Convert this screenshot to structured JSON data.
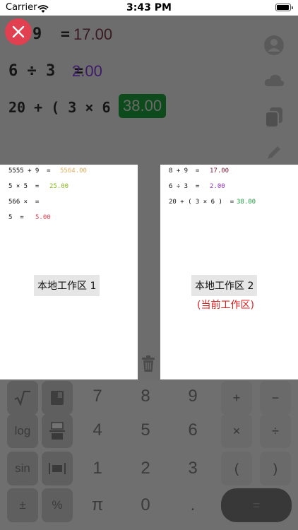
{
  "status_bar": {
    "carrier": "Carrier",
    "time": "3:43 PM"
  },
  "main": {
    "expressions": [
      {
        "expr": "9  =",
        "result": "17.00",
        "color": "#3a1a22"
      },
      {
        "expr": "6 ÷ 3  =",
        "result": "2.00",
        "color": "#3e1b6b"
      },
      {
        "expr": "20 + ( 3 × 6 )  =",
        "result": "38.00",
        "color": "#0d4a1c"
      }
    ],
    "side_icons": [
      "person-icon",
      "cloud-icon",
      "copy-icon",
      "pen-icon"
    ]
  },
  "workspaces": [
    {
      "lines": [
        {
          "expr": "5555 + 9  =",
          "value": "5564.00",
          "color": "#e0b060"
        },
        {
          "expr": "5 × 5  =",
          "value": "25.00",
          "color": "#8ab820"
        },
        {
          "expr": "566 ×  =",
          "value": "",
          "color": "#111111"
        },
        {
          "expr": "5  =",
          "value": "5.00",
          "color": "#e04050"
        }
      ],
      "label": "本地工作区 1"
    },
    {
      "lines": [
        {
          "expr": "8 + 9  =",
          "value": "17.00",
          "color": "#7a1a30"
        },
        {
          "expr": "6 ÷ 3  =",
          "value": "2.00",
          "color": "#9030c0"
        },
        {
          "expr": "20 + ( 3 × 6 )  =",
          "value": "38.00",
          "color": "#20a040"
        }
      ],
      "label": "本地工作区 2",
      "current": "(当前工作区)"
    }
  ],
  "keypad": {
    "row1": [
      "7",
      "8",
      "9",
      "+",
      "−"
    ],
    "row2": [
      "log",
      "4",
      "5",
      "6",
      "×",
      "÷"
    ],
    "row3": [
      "sin",
      "1",
      "2",
      "3",
      "(",
      ")"
    ],
    "row4": [
      "±",
      "%",
      "π",
      "0",
      ".",
      "="
    ]
  }
}
